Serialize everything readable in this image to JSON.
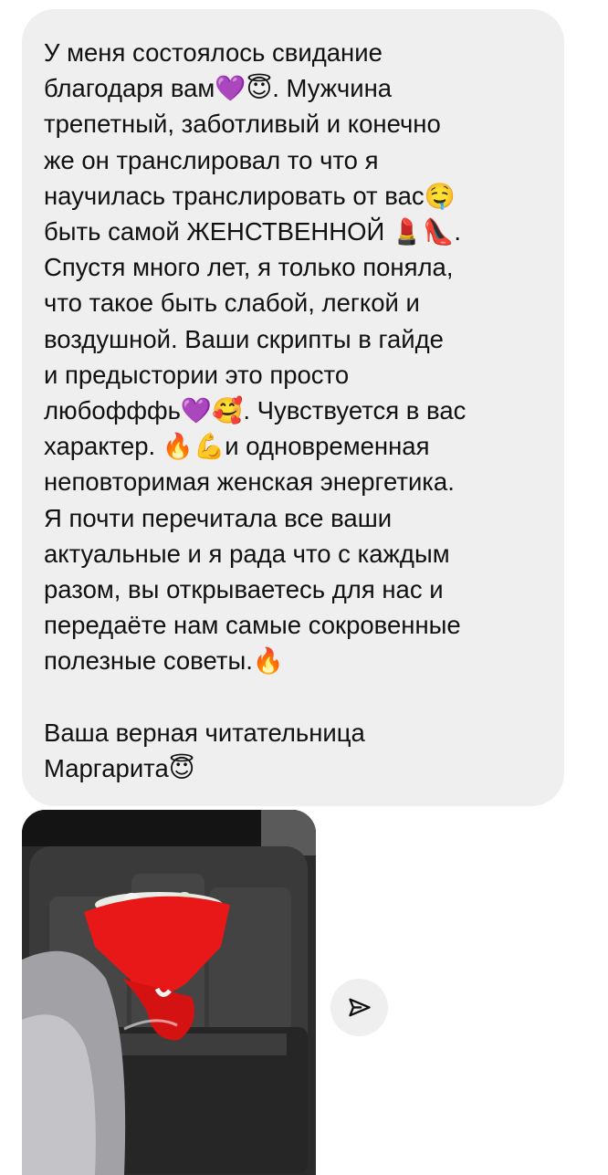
{
  "message": {
    "lines": [
      "У меня состоялось свидание",
      "благодаря вам💜😇. Мужчина",
      "трепетный, заботливый и конечно",
      "же он транслировал то что я",
      "научилась транслировать от вас🤤",
      "быть самой ЖЕНСТВЕННОЙ 💄👠.",
      "Спустя много лет, я только поняла,",
      "что такое быть слабой, легкой и",
      "воздушной. Ваши скрипты в гайде",
      "и предыстории это просто",
      "любофффь💜🥰. Чувствуется в вас",
      "характер. 🔥💪и одновременная",
      "неповторимая женская энергетика.",
      "Я почти перечитала все ваши",
      "актуальные и я рада что с каждым",
      "разом, вы открываетесь для нас и",
      "передаёте нам самые сокровенные",
      "полезные советы.🔥",
      "",
      "Ваша верная читательница",
      "Маргарита😇"
    ]
  },
  "icons": {
    "share": "paper-plane-icon"
  }
}
